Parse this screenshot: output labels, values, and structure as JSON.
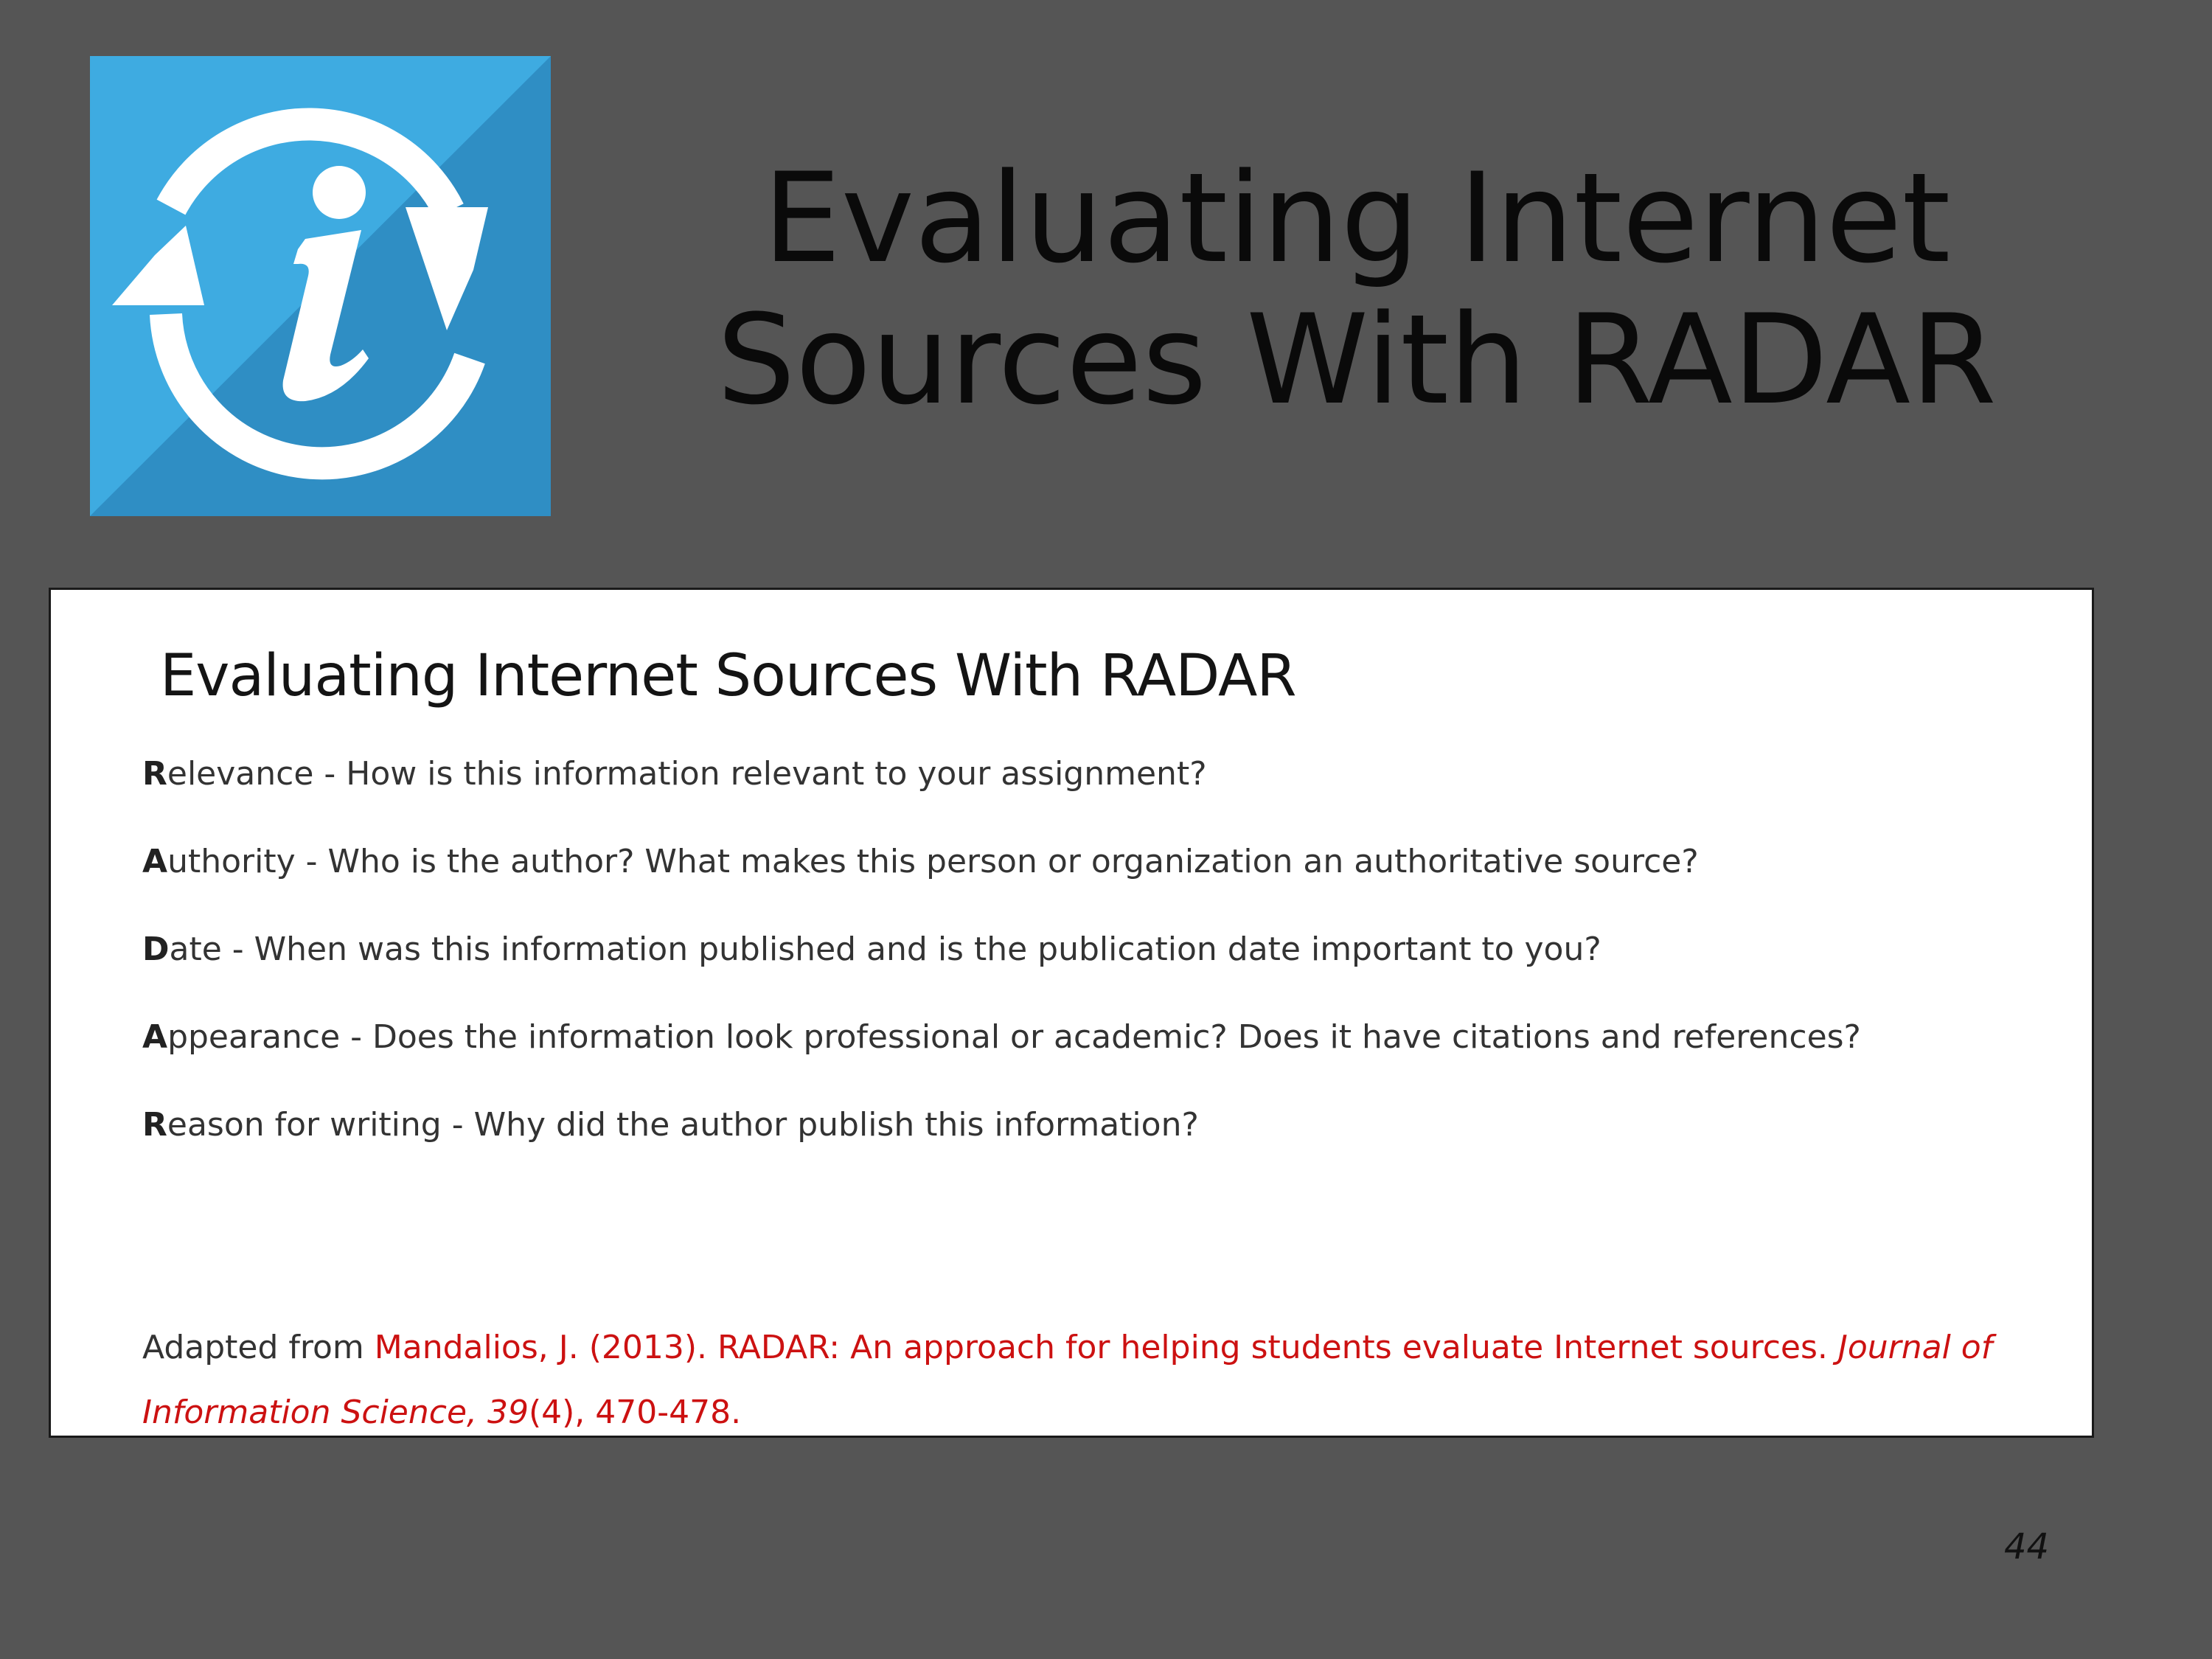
{
  "slide": {
    "title_line1": "Evaluating Internet",
    "title_line2": "Sources With RADAR",
    "page_number": "44"
  },
  "logo": {
    "icon": "info-cycle-icon",
    "glyph": "i",
    "colors": {
      "light_blue": "#3eabe1",
      "dark_blue": "#2f8ec4",
      "white": "#ffffff"
    }
  },
  "panel": {
    "title": "Evaluating Internet Sources With RADAR",
    "criteria": [
      {
        "first_letter": "R",
        "rest": "elevance - How is this information relevant to your assignment?"
      },
      {
        "first_letter": "A",
        "rest": "uthority - Who is the author? What makes this person or organization an authoritative source?"
      },
      {
        "first_letter": "D",
        "rest": "ate - When was this information published and is the publication date important to you?"
      },
      {
        "first_letter": "A",
        "rest": "ppearance - Does the information look professional or academic? Does it have citations and references?"
      },
      {
        "first_letter": "R",
        "rest": "eason for writing - Why did the author publish this information?"
      }
    ],
    "citation": {
      "lead": "Adapted from ",
      "reference": "Mandalios, J. (2013). RADAR: An approach for helping students evaluate Internet sources. ",
      "journal": "Journal of Information Science, 39",
      "issue_pages": "(4), 470-478."
    },
    "colors": {
      "reference_red": "#cc1111",
      "text_gray": "#333333"
    }
  },
  "background_color": "#555555"
}
